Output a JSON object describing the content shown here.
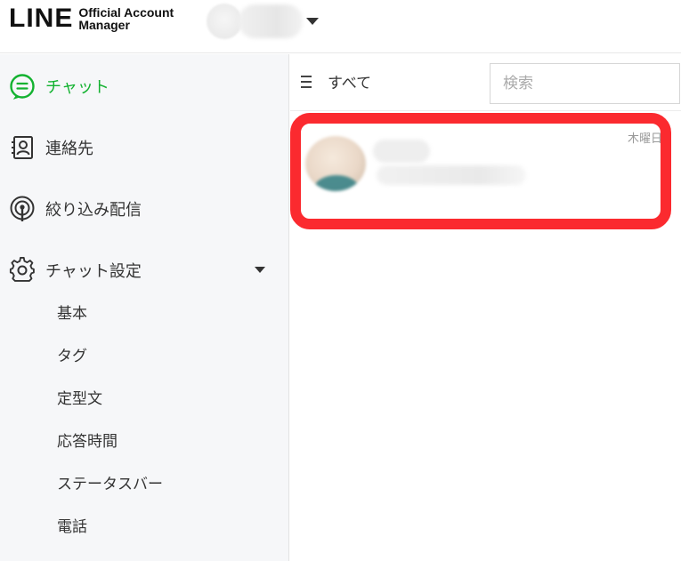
{
  "header": {
    "logo_main": "LINE",
    "logo_sub_line1": "Official Account",
    "logo_sub_line2": "Manager"
  },
  "sidebar": {
    "items": [
      {
        "label": "チャット",
        "icon": "chat-bubble-icon",
        "active": true
      },
      {
        "label": "連絡先",
        "icon": "contact-card-icon"
      },
      {
        "label": "絞り込み配信",
        "icon": "broadcast-icon"
      },
      {
        "label": "チャット設定",
        "icon": "gear-icon",
        "expanded": true
      }
    ],
    "sub_items": [
      "基本",
      "タグ",
      "定型文",
      "応答時間",
      "ステータスバー",
      "電話"
    ]
  },
  "main": {
    "filter_label": "すべて",
    "search_placeholder": "検索",
    "chats": [
      {
        "date": "木曜日"
      }
    ]
  },
  "colors": {
    "accent_green": "#13b230",
    "highlight_red": "#fb2a2f"
  }
}
